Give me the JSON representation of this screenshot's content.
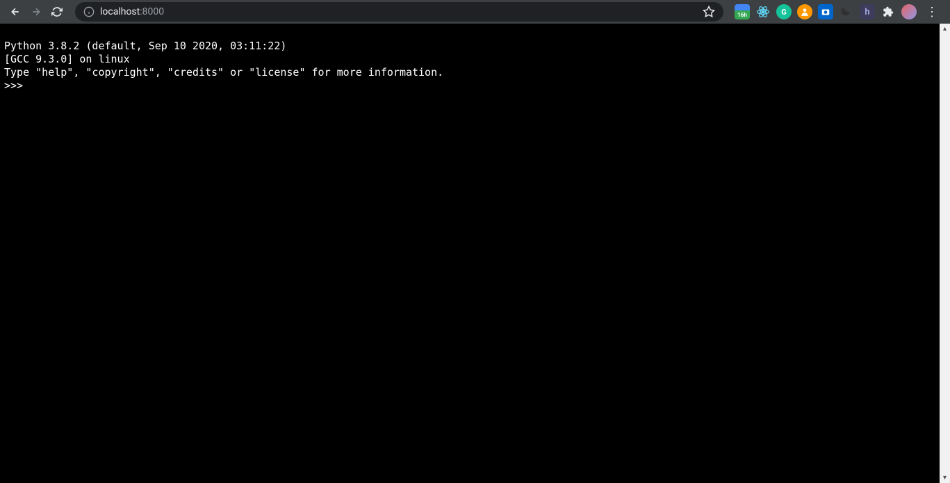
{
  "browser": {
    "url_host": "localhost",
    "url_port": ":8000",
    "calendar_badge": "16h"
  },
  "terminal": {
    "line1": "Python 3.8.2 (default, Sep 10 2020, 03:11:22) ",
    "line2": "[GCC 9.3.0] on linux",
    "line3": "Type \"help\", \"copyright\", \"credits\" or \"license\" for more information.",
    "prompt": ">>> "
  }
}
